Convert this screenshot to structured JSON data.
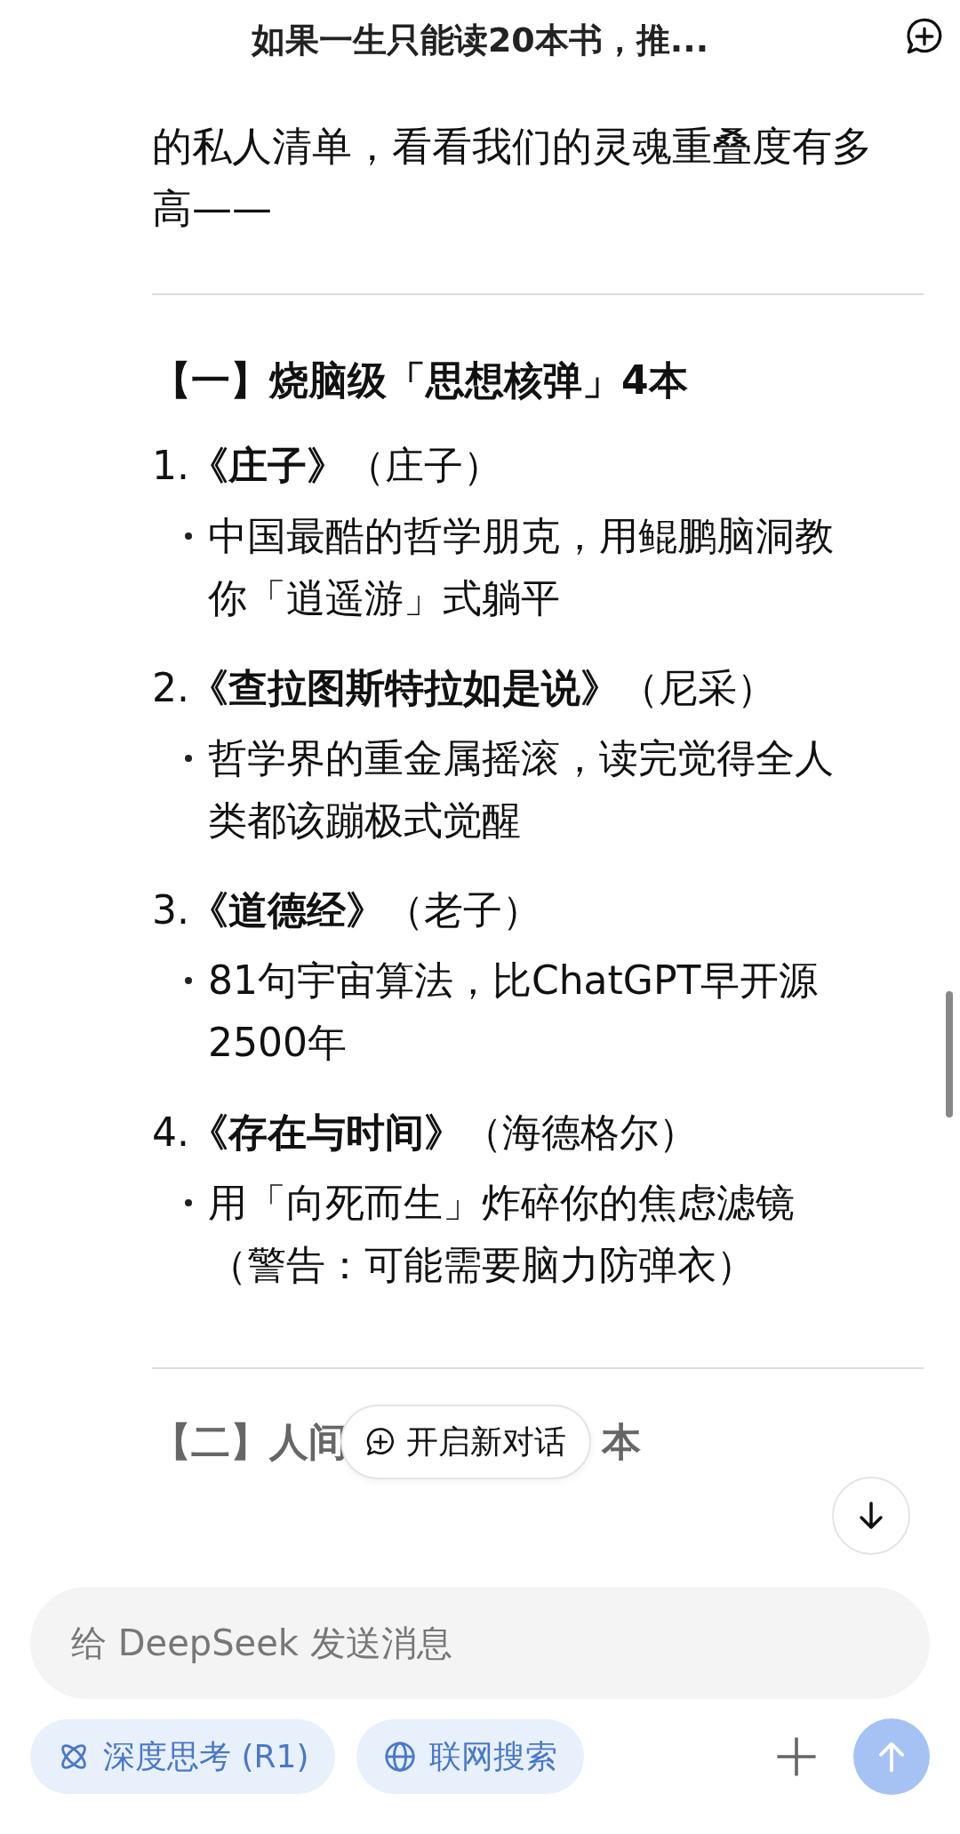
{
  "header": {
    "title": "如果一生只能读20本书，推..."
  },
  "intro_lines": [
    "的私人清单，看看我们的灵魂重叠度有多",
    "高——"
  ],
  "sections": [
    {
      "heading": "【一】烧脑级「思想核弹」4本",
      "books": [
        {
          "title": "1.**《庄子》**（庄子）",
          "notes": [
            "中国最酷的哲学朋克，用鲲鹏脑洞教你「逍遥游」式躺平"
          ]
        },
        {
          "title": "2.**《查拉图斯特拉如是说》**（尼采）",
          "notes": [
            "哲学界的重金属摇滚，读完觉得全人类都该蹦极式觉醒"
          ]
        },
        {
          "title": "3.**《道德经》**（老子）",
          "notes": [
            "81句宇宙算法，比ChatGPT早开源2500年"
          ]
        },
        {
          "title": "4.**《存在与时间》**（海德格尔）",
          "notes": [
            "用「向死而生」炸碎你的焦虑滤镜（警告：可能需要脑力防弹衣）"
          ]
        }
      ]
    }
  ],
  "partial_heading": {
    "left": "【二】人间",
    "right": "本"
  },
  "new_chat_button": {
    "label": "开启新对话"
  },
  "composer": {
    "placeholder": "给 DeepSeek 发送消息"
  },
  "chips": [
    {
      "kind": "think",
      "label": "深度思考 (R1)",
      "selected": false
    },
    {
      "kind": "web",
      "label": "联网搜索",
      "selected": false
    }
  ]
}
